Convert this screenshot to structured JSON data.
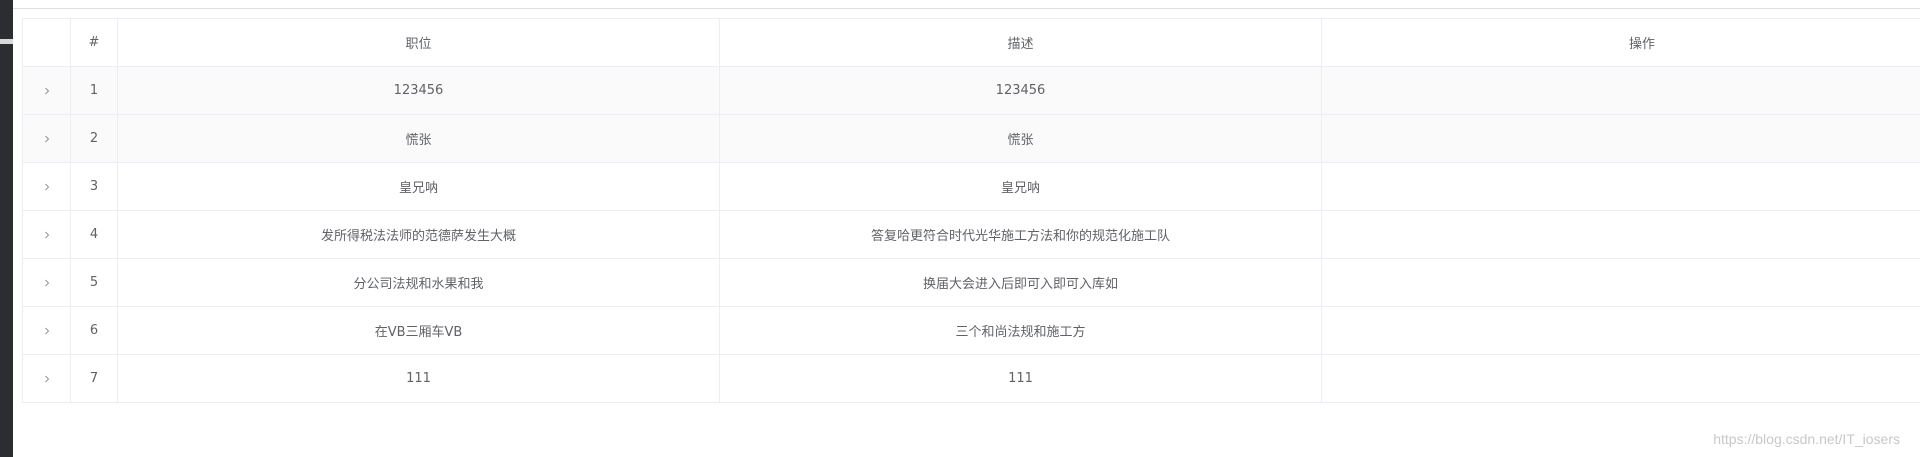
{
  "table": {
    "headers": {
      "index": "#",
      "position": "职位",
      "description": "描述",
      "actions": "操作"
    },
    "rows": [
      {
        "index": "1",
        "position": "123456",
        "description": "123456",
        "striped": true
      },
      {
        "index": "2",
        "position": "慌张",
        "description": "慌张",
        "striped": true
      },
      {
        "index": "3",
        "position": "皇兄呐",
        "description": "皇兄呐",
        "striped": false
      },
      {
        "index": "4",
        "position": "发所得税法法师的范德萨发生大概",
        "description": "答复哈更符合时代光华施工方法和你的规范化施工队",
        "striped": false
      },
      {
        "index": "5",
        "position": "分公司法规和水果和我",
        "description": "换届大会进入后即可入即可入库如",
        "striped": false
      },
      {
        "index": "6",
        "position": "在VB三厢车VB",
        "description": "三个和尚法规和施工方",
        "striped": false
      },
      {
        "index": "7",
        "position": "111",
        "description": "111",
        "striped": false
      }
    ]
  },
  "watermark": "https://blog.csdn.net/IT_iosers",
  "colors": {
    "border": "#ebeef5",
    "text": "#606266",
    "stripe": "#fafafa",
    "sidebar": "#2b2d30"
  },
  "icons": {
    "expand": "chevron-right-icon"
  }
}
